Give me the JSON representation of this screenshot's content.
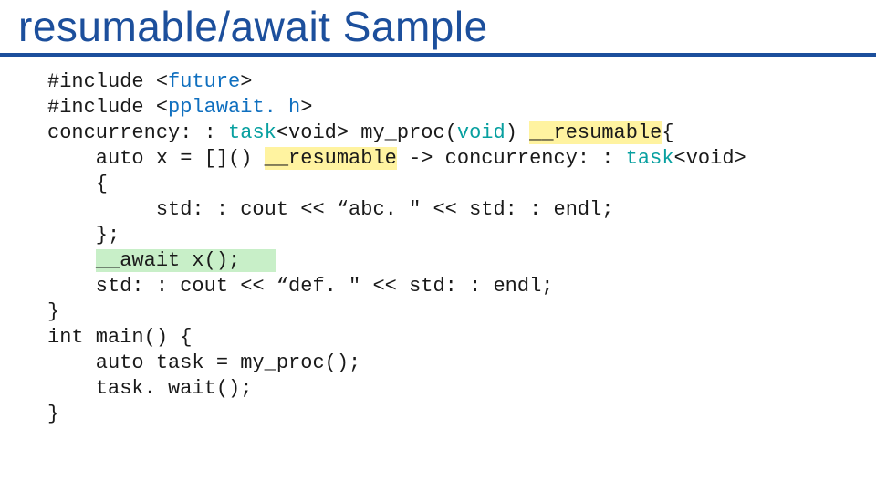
{
  "title": "resumable/await Sample",
  "code": {
    "l1": {
      "a": "#include <",
      "b": "future",
      "c": ">"
    },
    "l2": {
      "a": "#include <",
      "b": "pplawait. h",
      "c": ">"
    },
    "l3": {
      "a": "concurrency: : ",
      "b": "task",
      "c": "<void> my_proc(",
      "d": "void",
      "e": ") ",
      "f": "__resumable",
      "g": "{"
    },
    "l4": {
      "a": "    auto x = []() ",
      "b": "__resumable",
      "c": " -> concurrency: : ",
      "d": "task",
      "e": "<void>"
    },
    "l5": "    {",
    "l6": "         std: : cout << “abc. \" << std: : endl;",
    "l7": "    };",
    "l8": {
      "a": "    ",
      "b": "__await x();   "
    },
    "l9": "    std: : cout << “def. \" << std: : endl;",
    "l10": "}",
    "l11": "int main() {",
    "l12": "    auto task = my_proc();",
    "l13": "    task. wait();",
    "l14": "}"
  }
}
